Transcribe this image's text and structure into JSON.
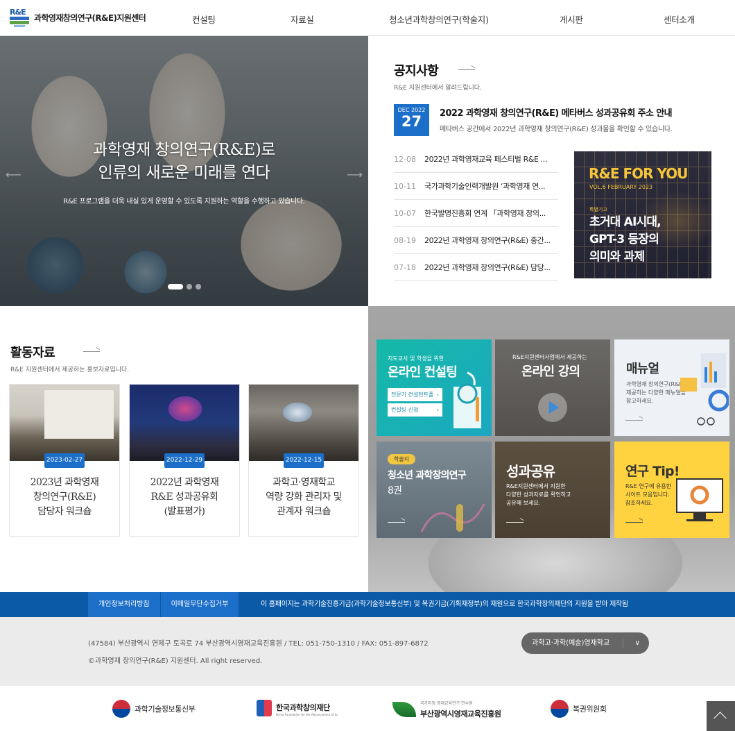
{
  "header": {
    "logo_mark": "R&E",
    "logo_text": "과학영재창의연구(R&E)지원센터",
    "nav": [
      "컨설팅",
      "자료실",
      "청소년과학창의연구(학술지)",
      "게시판",
      "센터소개"
    ]
  },
  "hero": {
    "title_line1": "과학영재 창의연구(R&E)로",
    "title_line2": "인류의 새로운 미래를 연다",
    "subtitle": "R&E 프로그램을 더욱 내실 있게 운영할 수 있도록 지원하는 역할을 수행하고 있습니다."
  },
  "notice": {
    "title": "공지사항",
    "desc": "R&E 지원센터에서 알려드립니다.",
    "featured": {
      "month": "DEC 2022",
      "day": "27",
      "title": "2022 과학영재 창의연구(R&E) 메타버스 성과공유회 주소 안내",
      "desc": "메타버스 공간에서 2022년 과학영재 창의연구(R&E) 성과물을 확인할 수 있습니다."
    },
    "items": [
      {
        "date": "12-08",
        "title": "2022년 과학영재교육 페스티벌 R&E ..."
      },
      {
        "date": "10-11",
        "title": "국가과학기술인력개발원 ‘과학영재 연..."
      },
      {
        "date": "10-07",
        "title": "한국발명진흥회 연계 「과학영재 창의..."
      },
      {
        "date": "08-19",
        "title": "2022년 과학영재 창의연구(R&E) 중간..."
      },
      {
        "date": "07-18",
        "title": "2022년 과학영재 창의연구(R&E) 담당..."
      }
    ]
  },
  "magazine": {
    "title": "R&E FOR YOU",
    "vol": "VOL.6  FEBRUARY 2023",
    "tag": "특별기고",
    "headline": "초거대 AI시대,\nGPT-3 등장의\n의미와 과제"
  },
  "activity": {
    "title": "활동자료",
    "desc": "R&E 지원센터에서 제공하는 홍보자료입니다.",
    "cards": [
      {
        "date": "2023-02-27",
        "title": "2023년 과학영재\n창의연구(R&E)\n담당자 워크숍"
      },
      {
        "date": "2022-12-29",
        "title": "2022년 과학영재\nR&E 성과공유회\n(발표평가)"
      },
      {
        "date": "2022-12-15",
        "title": "과학고·영재학교\n역량 강화 관리자 및\n관계자 워크숍"
      }
    ]
  },
  "tiles": {
    "consult": {
      "small": "지도교사 및 학생을 위한",
      "big": "온라인 컨설팅",
      "btn1": "전문가 컨설턴트풀",
      "btn2": "컨설팅 신청"
    },
    "lecture": {
      "small": "R&E지원센터사업에서 제공하는",
      "big": "온라인 강의"
    },
    "manual": {
      "big": "매뉴얼",
      "desc": "과학영재 창의연구(R&E)에서\n제공하는 다양한 매뉴얼을\n참고하세요."
    },
    "journal": {
      "badge": "학술지",
      "big": "청소년 과학창의연구",
      "sub": "8권"
    },
    "share": {
      "big": "성과공유",
      "desc": "R&E지원센터에서 지원한\n다양한 성과자료를 확인하고\n공유해 보세요."
    },
    "tip": {
      "big": "연구 Tip!",
      "desc": "R&E 연구에 유용한\n사이트 모음입니다.\n참조하세요."
    }
  },
  "footer": {
    "policy1": "개인정보처리방침",
    "policy2": "이메일무단수집거부",
    "note": "이 홈페이지는 과학기술진흥기금(과학기술정보통신부) 및 복권기금(기획재정부)의 재원으로 한국과학창의재단의 지원을 받아 제작됨",
    "address": "(47584) 부산광역시 연제구 토곡로 74 부산광역시영재교육진흥원  /   TEL: 051-750-1310  /   FAX: 051-897-6872",
    "copyright": "©과학영재 창의연구(R&E) 지원센터. All right reserved.",
    "school_select": "과학고·과학(예술)영재학교",
    "partners": [
      "과학기술정보통신부",
      "한국과학창의재단",
      "부산광역시영재교육진흥원",
      "복권위원회"
    ],
    "partner_subs": [
      "Korea Foundation for the Advancement of Science & Creativity",
      "국가지정 영재교육연구·연수원"
    ]
  },
  "colors": {
    "primary": "#1c6fc9",
    "policy_bar": "#0b5aa8",
    "magazine_accent": "#f5c43a"
  }
}
